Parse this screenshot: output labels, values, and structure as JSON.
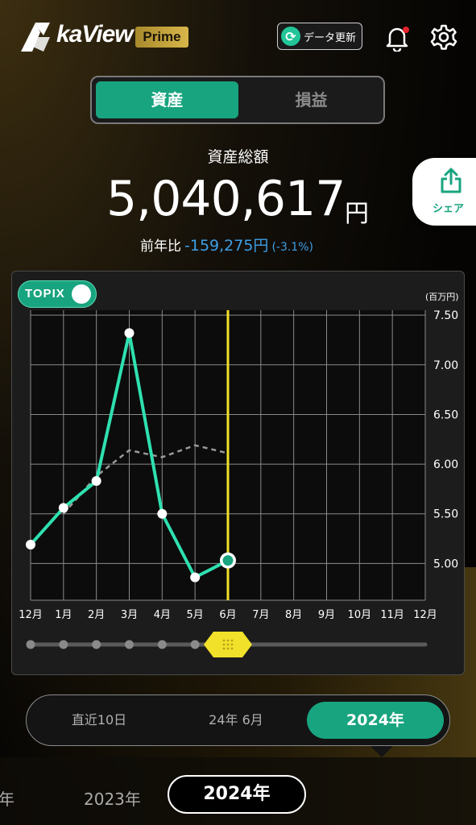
{
  "app": {
    "brand_name": "kaView",
    "brand_badge": "Prime"
  },
  "header": {
    "refresh_label": "データ更新"
  },
  "tabs": {
    "items": [
      {
        "label": "資産",
        "active": true
      },
      {
        "label": "損益",
        "active": false
      }
    ]
  },
  "summary": {
    "label": "資産総額",
    "total": "5,040,617",
    "unit": "円",
    "yoy_label": "前年比",
    "yoy_value": "-159,275円",
    "yoy_percent": "(-3.1%)"
  },
  "share": {
    "label": "シェア"
  },
  "chart_toggle": {
    "label": "TOPIX",
    "on": true
  },
  "colors": {
    "accent": "#18a47f",
    "line": "#2fe0b0",
    "benchmark": "#9a9a9a",
    "cursor": "#f2e12a",
    "negative": "#3d9fe6"
  },
  "chart_data": {
    "type": "line",
    "unit_label": "(百万円)",
    "x_ticks": [
      "12月",
      "1月",
      "2月",
      "3月",
      "4月",
      "5月",
      "6月",
      "7月",
      "8月",
      "9月",
      "10月",
      "11月",
      "12月"
    ],
    "y_ticks": [
      "7.50",
      "7.00",
      "6.50",
      "6.00",
      "5.50",
      "5.00"
    ],
    "ylim": [
      4.63,
      7.55
    ],
    "grid": true,
    "cursor_index": 6,
    "series": [
      {
        "values": [
          5.19,
          5.56,
          5.83,
          7.32,
          5.5,
          4.86,
          5.03
        ]
      },
      {
        "values": [
          null,
          5.5,
          5.88,
          6.14,
          6.07,
          6.19,
          6.11
        ]
      }
    ]
  }
}
